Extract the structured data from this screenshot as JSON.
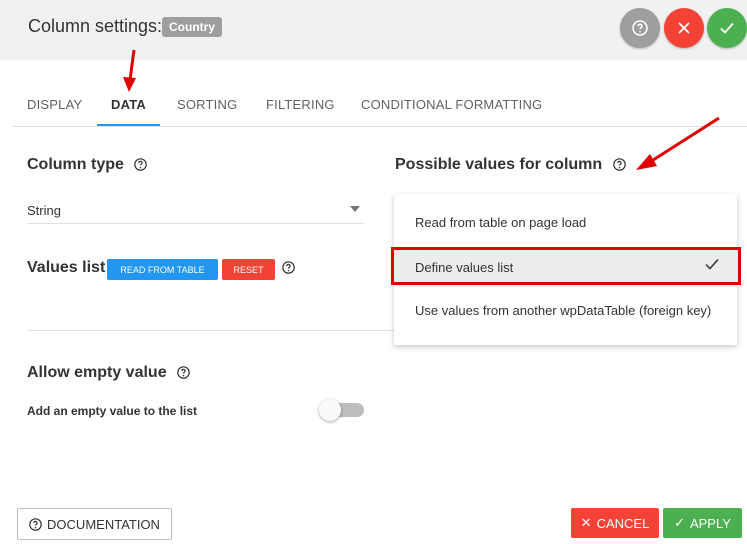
{
  "header": {
    "title": "Column settings:",
    "badge": "Country"
  },
  "tabs": [
    {
      "label": "DISPLAY",
      "active": false
    },
    {
      "label": "DATA",
      "active": true
    },
    {
      "label": "SORTING",
      "active": false
    },
    {
      "label": "FILTERING",
      "active": false
    },
    {
      "label": "CONDITIONAL FORMATTING",
      "active": false
    }
  ],
  "column_type": {
    "label": "Column type",
    "value": "String"
  },
  "values_list": {
    "label": "Values list",
    "read_button": "READ FROM TABLE",
    "reset_button": "RESET"
  },
  "possible_values": {
    "label": "Possible values for column",
    "options": [
      {
        "label": "Read from table on page load",
        "selected": false
      },
      {
        "label": "Define values list",
        "selected": true
      },
      {
        "label": "Use values from another wpDataTable (foreign key)",
        "selected": false
      }
    ]
  },
  "allow_empty": {
    "label": "Allow empty value",
    "toggle_label": "Add an empty value to the list",
    "enabled": false
  },
  "footer": {
    "documentation": "DOCUMENTATION",
    "cancel": "CANCEL",
    "apply": "APPLY"
  },
  "colors": {
    "primary": "#2196f3",
    "danger": "#f44336",
    "success": "#4caf50",
    "annotation": "#e00000"
  },
  "icons": [
    "help-icon",
    "close-icon",
    "check-icon",
    "caret-down-icon"
  ]
}
